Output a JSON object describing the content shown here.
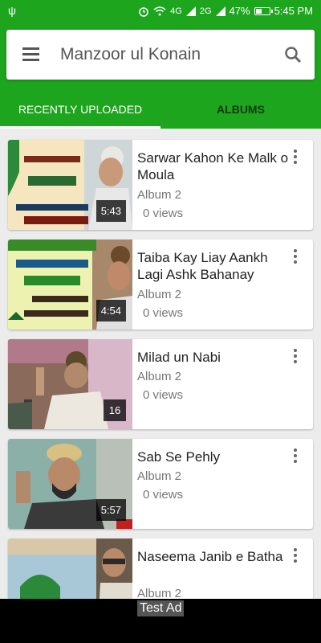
{
  "status_bar": {
    "usb_icon": "usb-icon",
    "alarm_icon": "alarm-icon",
    "wifi_icon": "wifi-icon",
    "signal_labels": [
      "4G",
      "2G"
    ],
    "battery_percent": "47%",
    "battery_level": 0.47,
    "time": "5:45 PM"
  },
  "header": {
    "title": "Manzoor ul Konain",
    "menu_icon": "menu-icon",
    "search_icon": "search-icon",
    "accent_color": "#1ea51e"
  },
  "tabs": [
    {
      "label": "RECENTLY UPLOADED",
      "active": true
    },
    {
      "label": "ALBUMS",
      "active": false
    }
  ],
  "videos": [
    {
      "title": "Sarwar Kahon Ke Malk o Moula",
      "album": "Album 2",
      "views": "0 views",
      "duration": "5:43"
    },
    {
      "title": "Taiba Kay Liay Aankh Lagi Ashk Bahanay",
      "album": "Album 2",
      "views": "0 views",
      "duration": "4:54"
    },
    {
      "title": "Milad un Nabi",
      "album": "Album 2",
      "views": "0 views",
      "duration": "16"
    },
    {
      "title": "Sab Se Pehly",
      "album": "Album 2",
      "views": "0 views",
      "duration": "5:57"
    },
    {
      "title": "Naseema Janib e Batha",
      "album": "Album 2",
      "views": "",
      "duration": ""
    }
  ],
  "ad": {
    "label": "Test Ad"
  }
}
